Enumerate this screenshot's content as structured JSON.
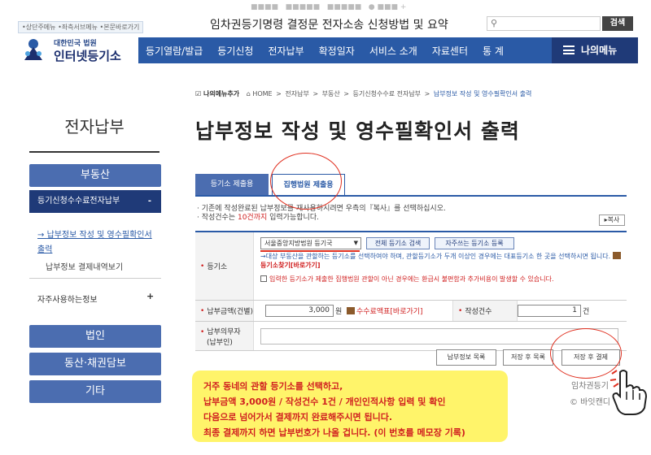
{
  "topbar": {
    "skip_links": [
      "상단주메뉴",
      "좌측서브메뉴",
      "본문바로가기"
    ],
    "overlay_title": "임차권등기명령 결정문 전자소송 신청방법 및 요약",
    "search_placeholder": "",
    "search_button": "검색"
  },
  "logo": {
    "line1": "대한민국 법원",
    "line2": "인터넷등기소"
  },
  "nav": {
    "items": [
      "등기열람/발급",
      "등기신청",
      "전자납부",
      "확정일자",
      "서비스 소개",
      "자료센터",
      "통 계"
    ],
    "my_menu": "나의메뉴"
  },
  "breadcrumb": {
    "favorite": "나의메뉴추가",
    "items": [
      "HOME",
      "전자납부",
      "부동산",
      "등기신청수수료 전자납부",
      "납부정보 작성 및 영수필확인서 출력"
    ],
    "separator": ">"
  },
  "sidebar": {
    "title": "전자납부",
    "menu_realestate": "부동산",
    "submenu_title": "등기신청수수료전자납부",
    "submenu_toggle": "-",
    "link_active": "납부정보 작성 및 영수필확인서 출력",
    "link_other": "납부정보 결제내역보기",
    "frequent": "자주사용하는정보",
    "frequent_toggle": "+",
    "menu_corporation": "법인",
    "menu_movable": "동산·채권담보",
    "menu_etc": "기타"
  },
  "page": {
    "title": "납부정보 작성 및 영수필확인서 출력",
    "tab_registry": "등기소 제출용",
    "tab_court": "집행법원 제출용",
    "notice_line1": "· 기존에 작성완료된 납부정보를 재사용하시려면 우측의『복사』를 선택하십시오.",
    "notice_line2_a": "· 작성건수는 ",
    "notice_line2_hl": "10건까지",
    "notice_line2_b": " 입력가능합니다.",
    "copy_button": "▸복사"
  },
  "form": {
    "court_label": "등기소",
    "court_selected": "서울중앙지방법원 등기국",
    "btn_all_court": "전체 등기소 검색",
    "btn_frequent_court": "자주쓰는 등기소 등록",
    "court_note": "→대상 부동산을 관할하는 등기소를 선택하여야 하며, 관할등기소가 두개 이상인 경우에는 대표등기소 한 곳을 선택하시면 됩니다.",
    "court_find": "등기소찾기[바로가기]",
    "court_check": "입력한 등기소가 제출한 집행법원 관할이 아닌 경우에는 환급시 불편함과 추가비용이 발생할 수 있습니다.",
    "amount_label": "납부금액(건별)",
    "amount_value": "3,000",
    "amount_unit": "원",
    "fee_link": "수수료액표[바로가기]",
    "count_label": "작성건수",
    "count_value": "1",
    "count_unit": "건",
    "payer_label_1": "납부의무자",
    "payer_label_2": "(납부인)"
  },
  "actions": {
    "list": "납부정보 목록",
    "save_list": "저장 후 목록",
    "save_pay": "저장 후 결제"
  },
  "annotation": {
    "note_lines": [
      "거주 동네의 관할 등기소를 선택하고,",
      "납부금액 3,000원 / 작성건수 1건 / 개인인적사항 입력 및 확인",
      "다음으로 넘어가서 결제까지 완료해주시면 됩니다.",
      "최종 결제까지 하면 납부번호가 나올 겁니다. (이 번호를 메모장 기록)"
    ],
    "watermark_1": "임차권등기",
    "watermark_2": "© 바잇캔디"
  }
}
